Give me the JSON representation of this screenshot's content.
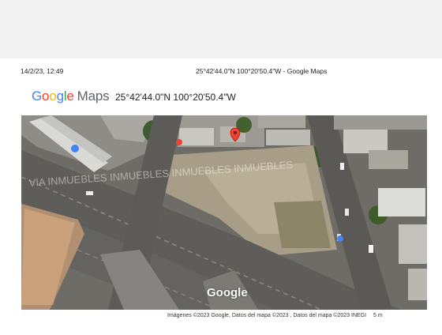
{
  "print_header": {
    "date_time": "14/2/23, 12:49",
    "title": "25°42'44.0\"N 100°20'50.4\"W - Google Maps"
  },
  "logo": {
    "google": "Google",
    "maps": "Maps",
    "colors": [
      "#4285F4",
      "#EA4335",
      "#FBBC05",
      "#4285F4",
      "#34A853",
      "#EA4335"
    ]
  },
  "location": {
    "coordinates": "25°42'44.0\"N 100°20'50.4\"W"
  },
  "map": {
    "type": "satellite",
    "watermark": "Google",
    "pin_color": "#EA4335",
    "overlay_watermark": "VIA INMUEBLES"
  },
  "footer": {
    "attribution": "Imágenes ©2023 Google, Datos del mapa ©2023 , Datos del mapa ©2023 INEGI",
    "scale": "5 m"
  }
}
